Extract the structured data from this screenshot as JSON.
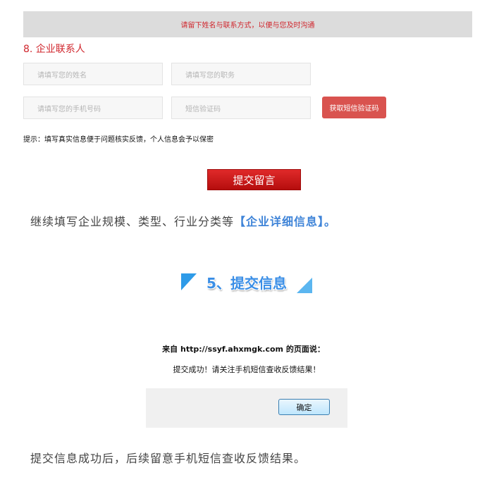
{
  "banner": {
    "text": "请留下姓名与联系方式，以便与您及时沟通"
  },
  "section": {
    "title": "8. 企业联系人"
  },
  "form": {
    "name_placeholder": "请填写您的姓名",
    "position_placeholder": "请填写您的职务",
    "phone_placeholder": "请填写您的手机号码",
    "sms_code_placeholder": "短信验证码",
    "get_code_label": "获取短信验证码",
    "hint": "提示：填写真实信息便于问题核实反馈，个人信息会予以保密",
    "submit_label": "提交留言"
  },
  "instruction": {
    "prefix": "继续填写企业规模、类型、行业分类等",
    "highlight": "【企业详细信息】。"
  },
  "step": {
    "title": "5、提交信息"
  },
  "dialog": {
    "title": "来自 http://ssyf.ahxmgk.com 的页面说：",
    "message": "提交成功！请关注手机短信查收反馈结果！",
    "ok_label": "确定"
  },
  "footer_text": "提交信息成功后，后续留意手机短信查收反馈结果。",
  "colors": {
    "accent_red": "#d0262d",
    "accent_blue": "#3a8ee6",
    "button_red": "#d9534f"
  }
}
